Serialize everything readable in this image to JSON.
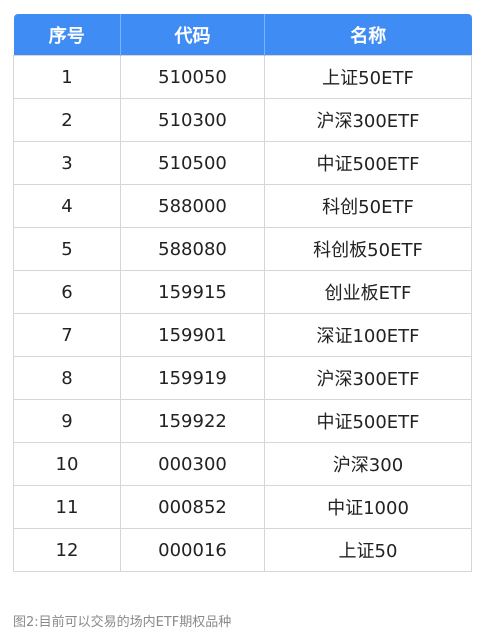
{
  "table": {
    "headers": [
      "序号",
      "代码",
      "名称"
    ],
    "rows": [
      [
        "1",
        "510050",
        "上证50ETF"
      ],
      [
        "2",
        "510300",
        "沪深300ETF"
      ],
      [
        "3",
        "510500",
        "中证500ETF"
      ],
      [
        "4",
        "588000",
        "科创50ETF"
      ],
      [
        "5",
        "588080",
        "科创板50ETF"
      ],
      [
        "6",
        "159915",
        "创业板ETF"
      ],
      [
        "7",
        "159901",
        "深证100ETF"
      ],
      [
        "8",
        "159919",
        "沪深300ETF"
      ],
      [
        "9",
        "159922",
        "中证500ETF"
      ],
      [
        "10",
        "000300",
        "沪深300"
      ],
      [
        "11",
        "000852",
        "中证1000"
      ],
      [
        "12",
        "000016",
        "上证50"
      ]
    ]
  },
  "caption": "图2:目前可以交易的场内ETF期权品种",
  "colors": {
    "header_bg": "#3f8cf4",
    "header_text": "#ffffff",
    "border": "#d6d6d6"
  }
}
